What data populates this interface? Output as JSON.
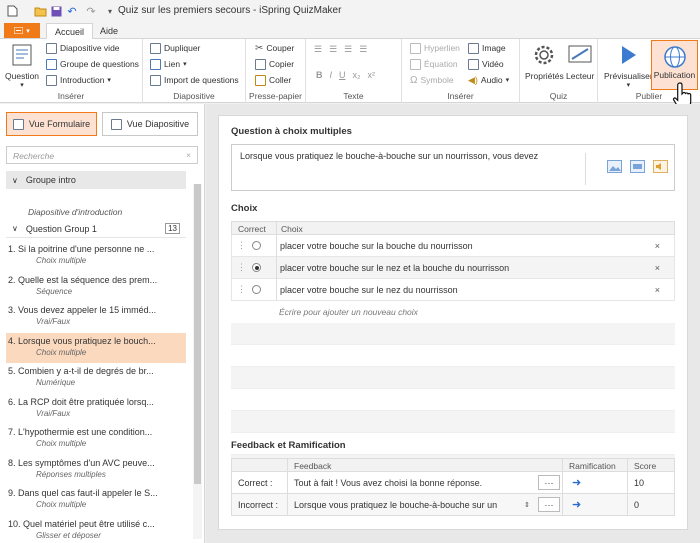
{
  "window": {
    "title": "Quiz sur les premiers secours - iSpring QuizMaker"
  },
  "tabs": {
    "file": "",
    "home": "Accueil",
    "help": "Aide"
  },
  "ribbon": {
    "question": "Question",
    "slide_empty": "Diapositive vide",
    "question_group": "Groupe de questions",
    "introduction": "Introduction",
    "group_insert": "Insérer",
    "duplicate": "Dupliquer",
    "link": "Lien",
    "import_questions": "Import de questions",
    "group_slide": "Diapositive",
    "cut": "Couper",
    "copy": "Copier",
    "paste": "Coller",
    "group_clipboard": "Presse-papier",
    "group_text": "Texte",
    "hyperlink": "Hyperlien",
    "equation": "Équation",
    "symbol": "Symbole",
    "image": "Image",
    "video": "Vidéo",
    "audio": "Audio",
    "group_insert2": "Insérer",
    "properties": "Propriétés",
    "player": "Lecteur",
    "group_quiz": "Quiz",
    "preview": "Prévisualiser",
    "publish": "Publication",
    "group_publish": "Publier",
    "fmt_bold": "B",
    "fmt_italic": "I",
    "fmt_underline": "U",
    "fmt_sub": "x₂",
    "fmt_sup": "x²"
  },
  "left": {
    "view_form": "Vue Formulaire",
    "view_slide": "Vue Diapositive",
    "search_placeholder": "Recherche",
    "group_intro": "Groupe intro",
    "intro_slide": "Diapositive d'introduction",
    "question_group": "Question Group 1",
    "question_count": "13",
    "questions": [
      {
        "title": "1. Si la poitrine d'une personne ne ...",
        "type": "Choix multiple"
      },
      {
        "title": "2. Quelle est la séquence des prem...",
        "type": "Séquence"
      },
      {
        "title": "3. Vous devez appeler le 15 imméd...",
        "type": "Vrai/Faux"
      },
      {
        "title": "4. Lorsque vous pratiquez le bouch...",
        "type": "Choix multiple"
      },
      {
        "title": "5. Combien y a-t-il de degrés de br...",
        "type": "Numérique"
      },
      {
        "title": "6. La RCP doit être pratiquée lorsq...",
        "type": "Vrai/Faux"
      },
      {
        "title": "7. L'hypothermie est une condition...",
        "type": "Choix multiple"
      },
      {
        "title": "8. Les symptômes d'un AVC peuve...",
        "type": "Réponses multiples"
      },
      {
        "title": "9. Dans quel cas faut-il appeler le S...",
        "type": "Choix multiple"
      },
      {
        "title": "10. Quel matériel peut être utilisé c...",
        "type": "Glisser et déposer"
      }
    ]
  },
  "main": {
    "section_question": "Question à choix multiples",
    "question_text": "Lorsque vous pratiquez le bouche-à-bouche sur un nourrisson, vous devez",
    "section_choices": "Choix",
    "col_correct": "Correct",
    "col_choice": "Choix",
    "choices": [
      {
        "text": "placer votre bouche sur la bouche du nourrisson"
      },
      {
        "text": "placer votre bouche sur le nez et la bouche du nourrisson"
      },
      {
        "text": "placer votre bouche sur le nez du nourrisson"
      }
    ],
    "add_choice": "Écrire pour ajouter un nouveau choix",
    "delete_glyph": "×",
    "section_feedback": "Feedback et Ramification",
    "col_feedback": "Feedback",
    "col_branching": "Ramification",
    "col_score": "Score",
    "correct_label": "Correct :",
    "correct_feedback": "Tout à fait ! Vous avez choisi la bonne réponse.",
    "correct_score": "10",
    "incorrect_label": "Incorrect :",
    "incorrect_feedback": "Lorsque vous pratiquez le bouche-à-bouche sur un",
    "incorrect_score": "0",
    "dots": "···"
  }
}
